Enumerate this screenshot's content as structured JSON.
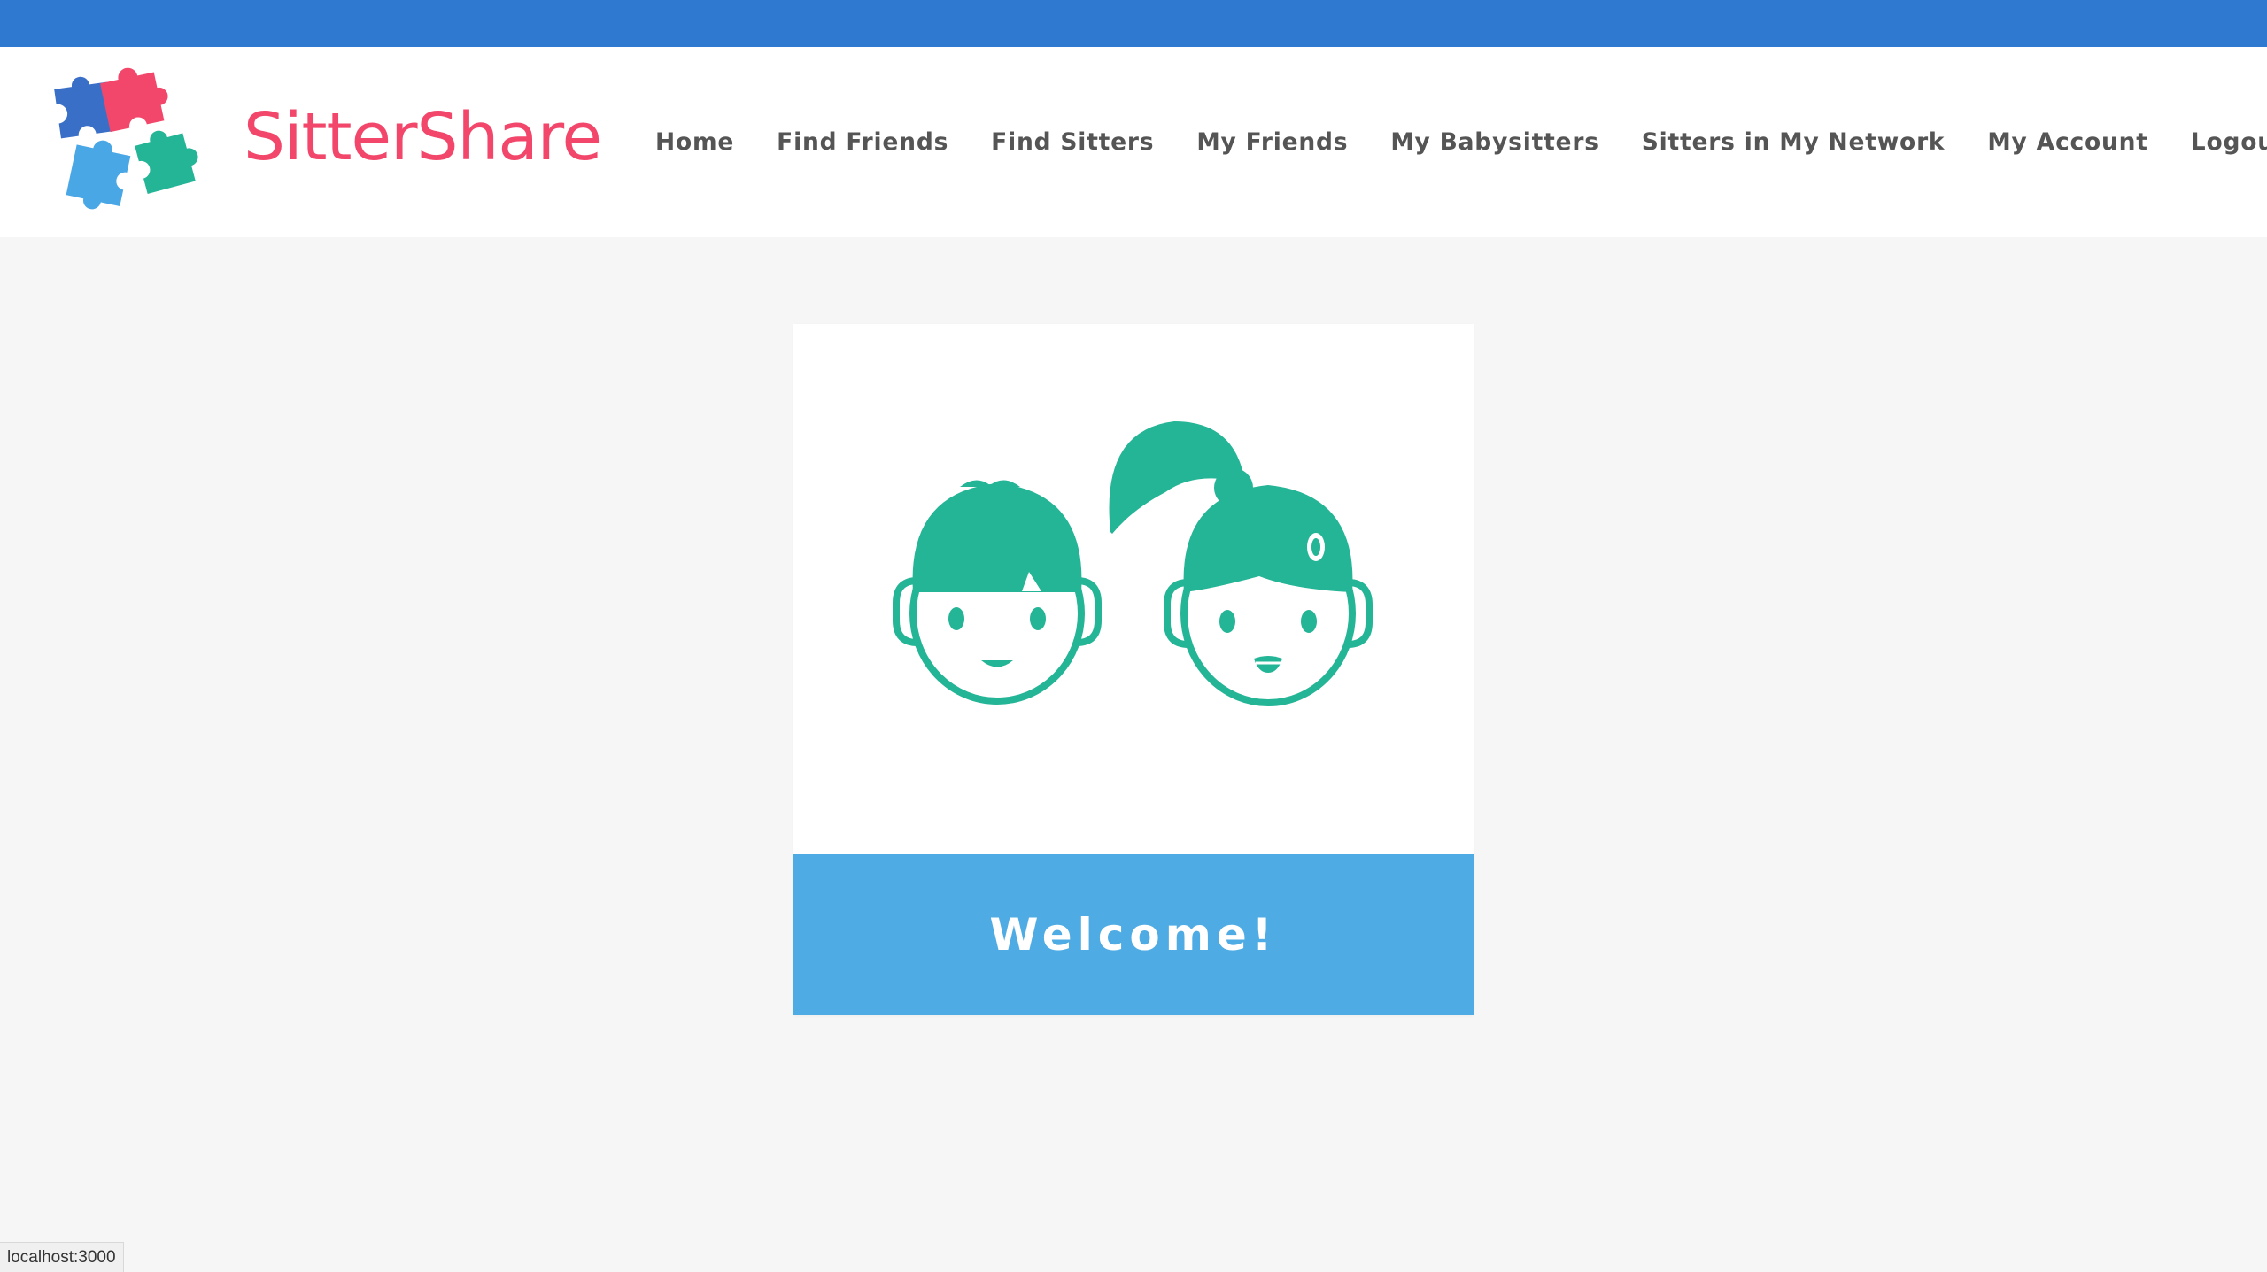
{
  "brand": {
    "name": "SitterShare",
    "logo_icon": "puzzle-pieces-logo",
    "name_color": "#f2476a"
  },
  "nav": {
    "items": [
      {
        "label": "Home"
      },
      {
        "label": "Find Friends"
      },
      {
        "label": "Find Sitters"
      },
      {
        "label": "My Friends"
      },
      {
        "label": "My Babysitters"
      },
      {
        "label": "Sitters in My Network"
      },
      {
        "label": "My Account"
      },
      {
        "label": "Logout"
      }
    ]
  },
  "welcome": {
    "image_icon": "kids-faces-icon",
    "title": "Welcome!",
    "banner_color": "#4eabe3",
    "icon_color": "#24b496"
  },
  "status_bar": {
    "url": "localhost:3000"
  },
  "colors": {
    "top_strip": "#3079d1",
    "page_background": "#f6f6f6",
    "puzzle_blue": "#3a6fc7",
    "puzzle_pink": "#f2476a",
    "puzzle_light_blue": "#4aa7e6",
    "puzzle_green": "#24b496"
  }
}
